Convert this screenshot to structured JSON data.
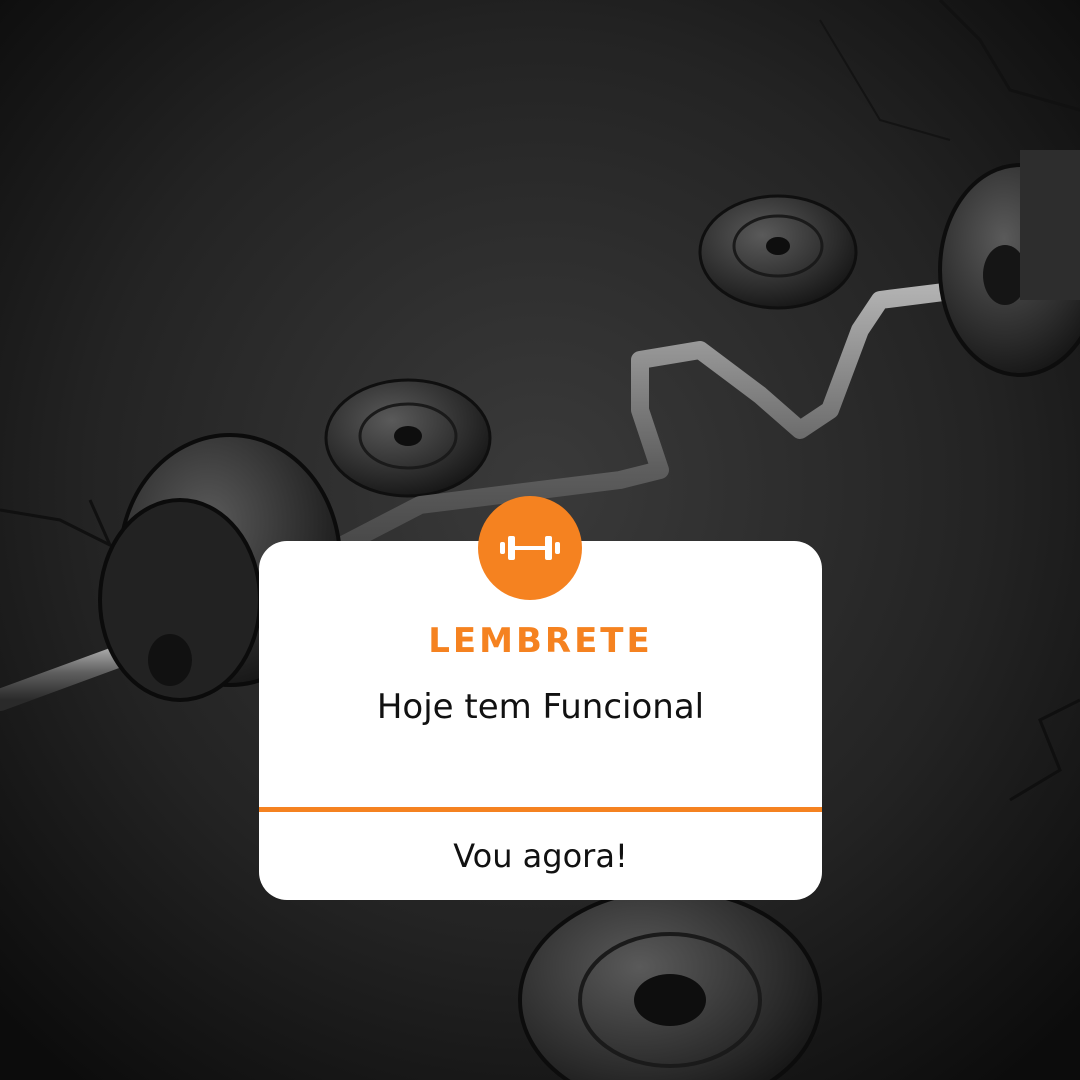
{
  "notification": {
    "title": "LEMBRETE",
    "message": "Hoje tem Funcional",
    "action_label": "Vou agora!",
    "icon": "dumbbell-icon"
  },
  "colors": {
    "accent": "#f58220",
    "card_background": "#ffffff",
    "text": "#111111",
    "background": "#1a1a1a"
  }
}
